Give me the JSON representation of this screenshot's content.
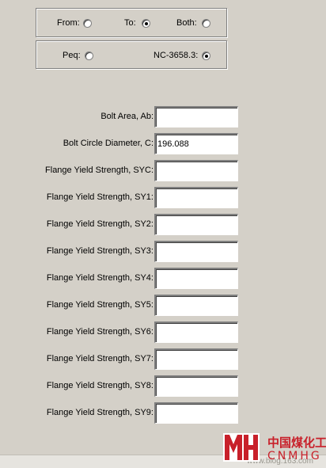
{
  "direction": {
    "from_label": "From:",
    "to_label": "To:",
    "both_label": "Both:",
    "selected": "To"
  },
  "method": {
    "peq_label": "Peq:",
    "nc_label": "NC-3658.3:",
    "selected": "NC-3658.3"
  },
  "fields": [
    {
      "label": "Bolt Area, Ab:",
      "value": ""
    },
    {
      "label": "Bolt Circle Diameter, C:",
      "value": "196.088"
    },
    {
      "label": "Flange Yield Strength, SYC:",
      "value": ""
    },
    {
      "label": "Flange Yield Strength, SY1:",
      "value": ""
    },
    {
      "label": "Flange Yield Strength, SY2:",
      "value": ""
    },
    {
      "label": "Flange Yield Strength, SY3:",
      "value": ""
    },
    {
      "label": "Flange Yield Strength, SY4:",
      "value": ""
    },
    {
      "label": "Flange Yield Strength, SY5:",
      "value": ""
    },
    {
      "label": "Flange Yield Strength, SY6:",
      "value": ""
    },
    {
      "label": "Flange Yield Strength, SY7:",
      "value": ""
    },
    {
      "label": "Flange Yield Strength, SY8:",
      "value": ""
    },
    {
      "label": "Flange Yield Strength, SY9:",
      "value": ""
    }
  ],
  "watermark": {
    "logo_cn": "中国煤化工",
    "logo_en": "CNMHG",
    "logo_mark": "MH",
    "url_text": "www.blog.163.com"
  },
  "colors": {
    "dialog_bg": "#d4d0c8",
    "logo_red": "#c8202a"
  }
}
